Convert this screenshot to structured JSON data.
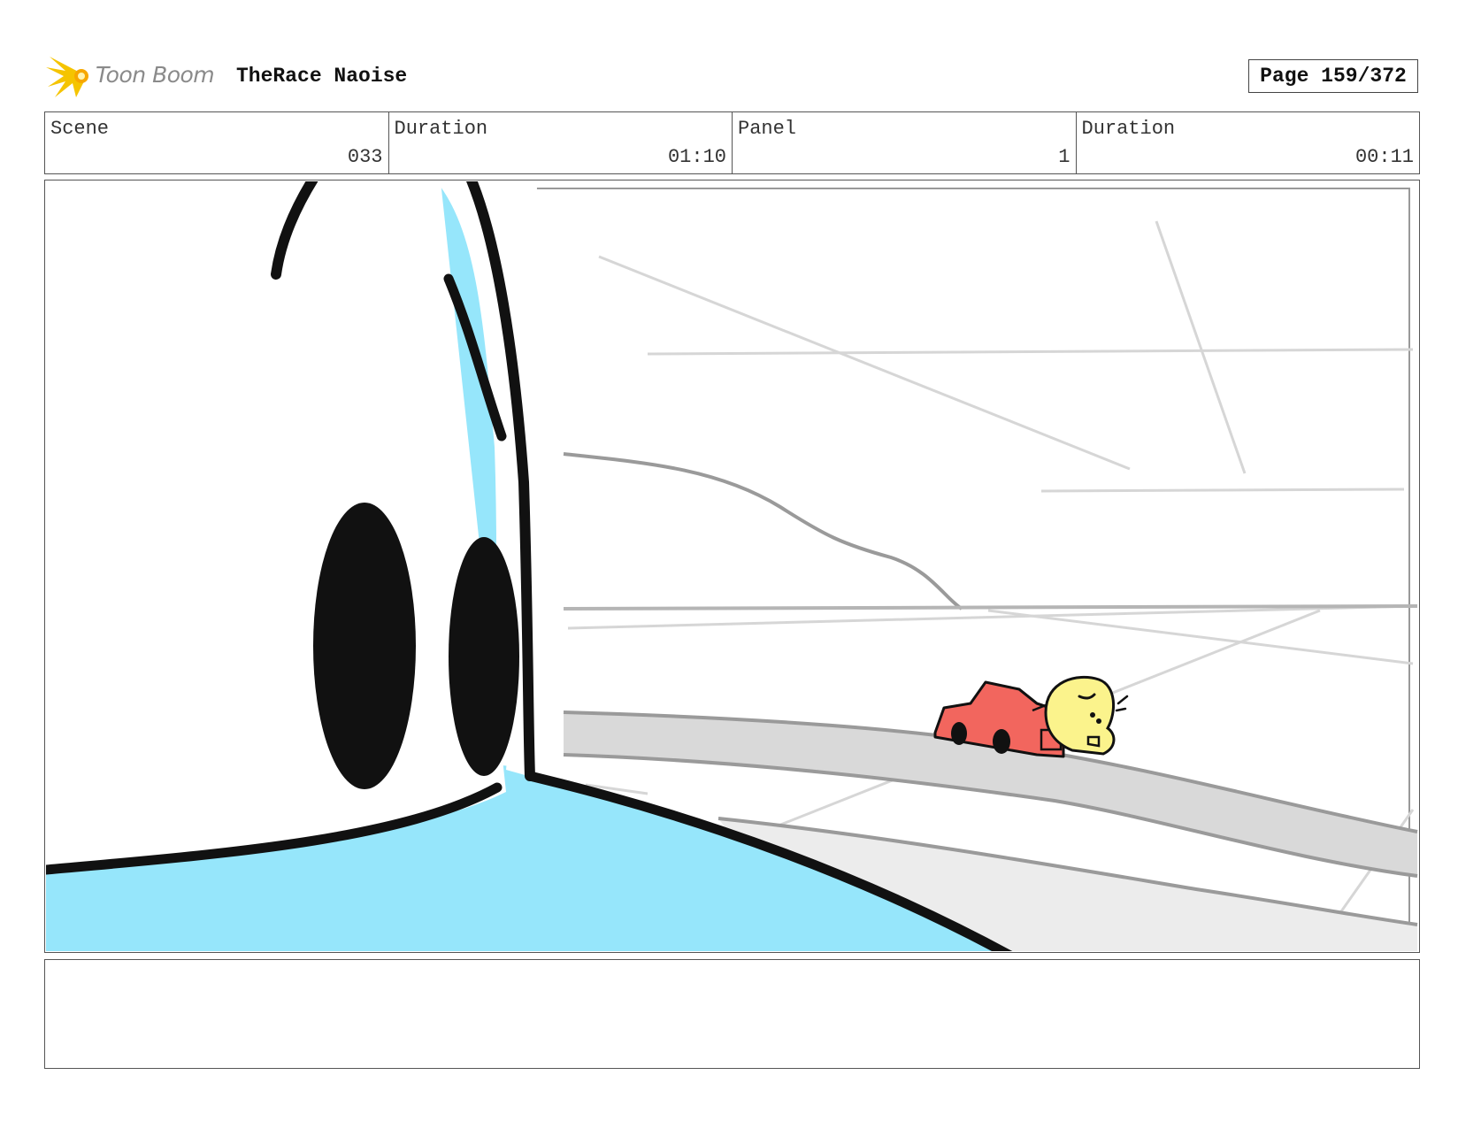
{
  "header": {
    "logo_text": "Toon Boom",
    "project_title": "TheRace Naoise",
    "page_label": "Page 159/372"
  },
  "info": [
    {
      "label": "Scene",
      "value": "033"
    },
    {
      "label": "Duration",
      "value": "01:10"
    },
    {
      "label": "Panel",
      "value": "1"
    },
    {
      "label": "Duration",
      "value": "00:11"
    }
  ],
  "notes": {
    "text": ""
  },
  "colors": {
    "water_blue": "#96e6fb",
    "car_red": "#f2665e",
    "character_yellow": "#fbf38c",
    "road_gray": "#d9d9d9",
    "logo_yellow": "#f5c400"
  }
}
